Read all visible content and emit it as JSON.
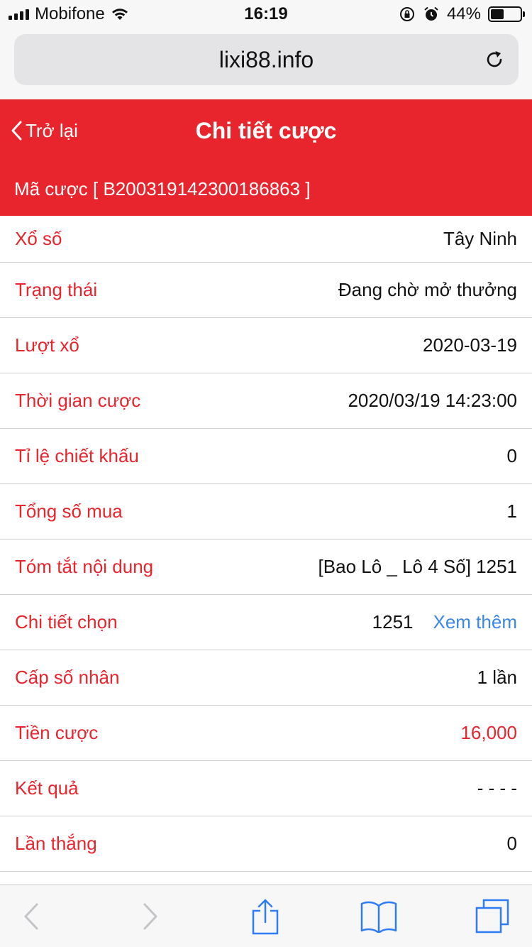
{
  "status_bar": {
    "carrier": "Mobifone",
    "time": "16:19",
    "battery_text": "44%",
    "battery_level": 0.44,
    "icons": [
      "signal-icon",
      "wifi-icon",
      "orientation-lock-icon",
      "alarm-icon",
      "battery-icon"
    ]
  },
  "browser": {
    "url": "lixi88.info"
  },
  "header": {
    "back_label": "Trở lại",
    "title": "Chi tiết cược",
    "bet_code": "Mã cược [ B200319142300186863 ]"
  },
  "details": {
    "lottery": {
      "label": "Xổ số",
      "value": "Tây Ninh"
    },
    "status": {
      "label": "Trạng thái",
      "value": "Đang chờ mở thưởng"
    },
    "draw": {
      "label": "Lượt xổ",
      "value": "2020-03-19"
    },
    "bet_time": {
      "label": "Thời gian cược",
      "value": "2020/03/19 14:23:00"
    },
    "discount": {
      "label": "Tỉ lệ chiết khấu",
      "value": "0"
    },
    "total_bought": {
      "label": "Tổng số mua",
      "value": "1"
    },
    "summary": {
      "label": "Tóm tắt nội dung",
      "value": "[Bao Lô _ Lô 4 Số] 1251"
    },
    "selection": {
      "label": "Chi tiết chọn",
      "value": "1251",
      "link": "Xem thêm"
    },
    "multiplier": {
      "label": "Cấp số nhân",
      "value": "1 lần"
    },
    "amount": {
      "label": "Tiền cược",
      "value": "16,000"
    },
    "result": {
      "label": "Kết quả",
      "value": "- - - -"
    },
    "wins": {
      "label": "Lần thắng",
      "value": "0"
    }
  },
  "colors": {
    "accent_red": "#e8242d",
    "link_blue": "#3b86e6",
    "safari_blue": "#2f7cf6"
  }
}
